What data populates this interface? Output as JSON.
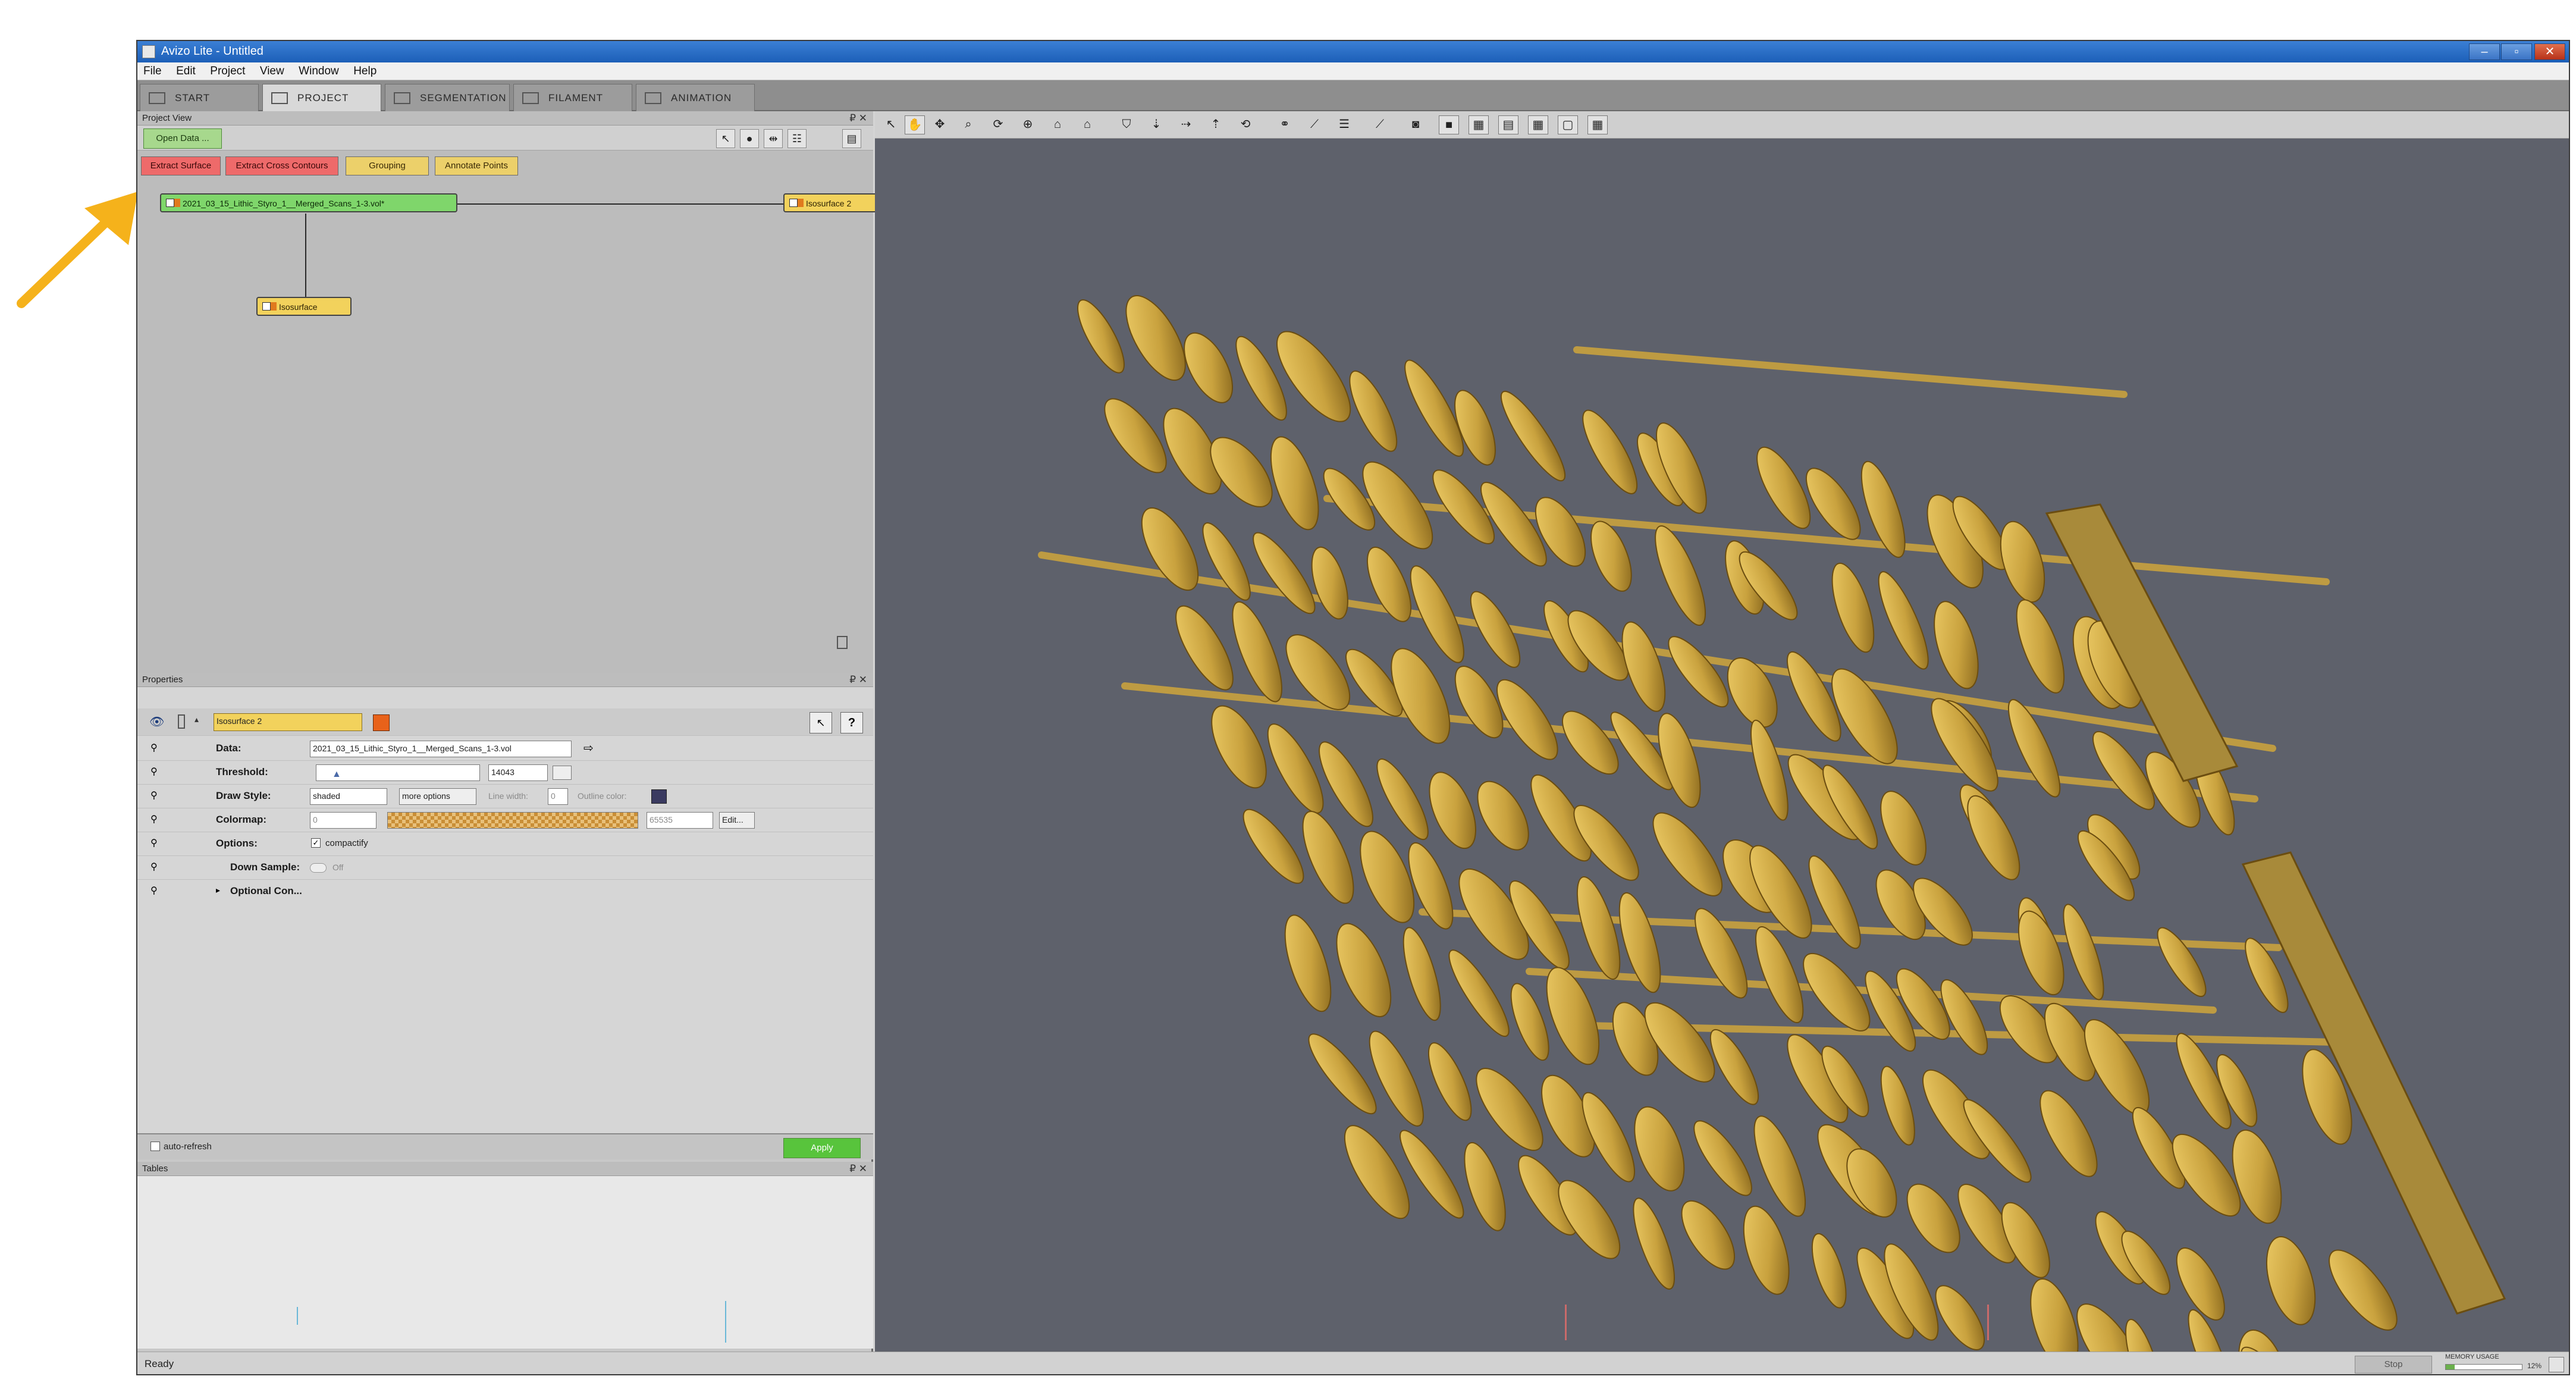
{
  "window": {
    "title": "Avizo Lite - Untitled",
    "controls": [
      "–",
      "▫",
      "✕"
    ]
  },
  "menu": [
    "File",
    "Edit",
    "Project",
    "View",
    "Window",
    "Help"
  ],
  "tabs": [
    {
      "label": "START",
      "icon": "home-icon",
      "active": false
    },
    {
      "label": "PROJECT",
      "icon": "project-icon",
      "active": true
    },
    {
      "label": "SEGMENTATION",
      "icon": "segmentation-icon",
      "active": false
    },
    {
      "label": "FILAMENT",
      "icon": "filament-icon",
      "active": false
    },
    {
      "label": "ANIMATION",
      "icon": "animation-icon",
      "active": false
    }
  ],
  "project_view": {
    "header": "Project View",
    "header_controls": "₽ ✕",
    "open_data_label": "Open Data ...",
    "module_buttons": [
      {
        "label": "Extract Surface",
        "color": "red"
      },
      {
        "label": "Extract Cross Contours",
        "color": "red"
      },
      {
        "label": "Grouping",
        "color": "yellow"
      },
      {
        "label": "Annotate Points",
        "color": "yellow"
      }
    ],
    "nodes": {
      "data": "2021_03_15_Lithic_Styro_1__Merged_Scans_1-3.vol*",
      "isosurface_1": "Isosurface",
      "isosurface_2": "Isosurface 2"
    }
  },
  "properties": {
    "header": "Properties",
    "header_controls": "₽ ✕",
    "module_name": "Isosurface 2",
    "module_color": "#e8621a",
    "rows": {
      "data_label": "Data:",
      "data_value": "2021_03_15_Lithic_Styro_1__Merged_Scans_1-3.vol",
      "threshold_label": "Threshold:",
      "threshold_value": "14043",
      "draw_style_label": "Draw Style:",
      "draw_style_value": "shaded",
      "more_options": "more options",
      "line_width_label": "Line width:",
      "line_width_value": "0",
      "outline_color_label": "Outline color:",
      "colormap_label": "Colormap:",
      "colormap_min": "0",
      "colormap_max": "65535",
      "colormap_edit": "Edit...",
      "options_label": "Options:",
      "options_value": "compactify",
      "down_sample_label": "Down Sample:",
      "down_sample_value": "Off",
      "optional_label": "Optional Con..."
    },
    "auto_refresh": "auto-refresh",
    "apply": "Apply"
  },
  "tables": {
    "header": "Tables",
    "header_controls": "₽ ✕"
  },
  "status": {
    "text": "Ready",
    "stop": "Stop",
    "memory_label": "MEMORY USAGE",
    "memory_value": "12%"
  },
  "viewer": {
    "background": "#5e616b",
    "surface_color": "#c9a23e"
  },
  "annotations": {
    "yellow_arrow_color": "#f5b21b",
    "blue_arrow_color": "#22a8e8"
  }
}
